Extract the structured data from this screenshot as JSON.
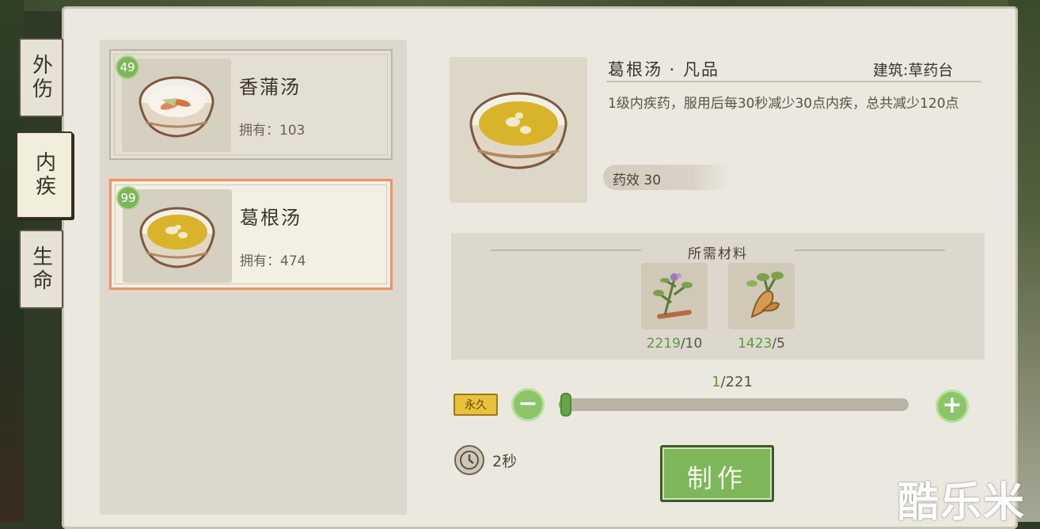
{
  "tabs": [
    {
      "label": "外伤",
      "active": false
    },
    {
      "label": "内疾",
      "active": true
    },
    {
      "label": "生命",
      "active": false
    }
  ],
  "recipes": [
    {
      "level": "49",
      "name": "香蒲汤",
      "owned": "拥有：103",
      "selected": false
    },
    {
      "level": "99",
      "name": "葛根汤",
      "owned": "拥有：474",
      "selected": true
    }
  ],
  "detail": {
    "title": "葛根汤 · 凡品",
    "building": "建筑:草药台",
    "description": "1级内疾药，服用后每30秒减少30点内疾，总共减少120点",
    "effect": "药效 30"
  },
  "materials": {
    "title": "所需材料",
    "items": [
      {
        "icon": "herb-plant-icon",
        "have": "2219",
        "need": "/10"
      },
      {
        "icon": "root-tuber-icon",
        "have": "1423",
        "need": "/5"
      }
    ]
  },
  "quantity": {
    "current": "1",
    "max": "/221",
    "fraction": 0.0045
  },
  "permanent_badge": "永久",
  "craft_time": "2秒",
  "make_button": "制作",
  "watermark": "酷乐米",
  "colors": {
    "accent_green": "#7eb65a",
    "selected_border": "#e8956f",
    "badge_gold": "#e8c23b"
  }
}
